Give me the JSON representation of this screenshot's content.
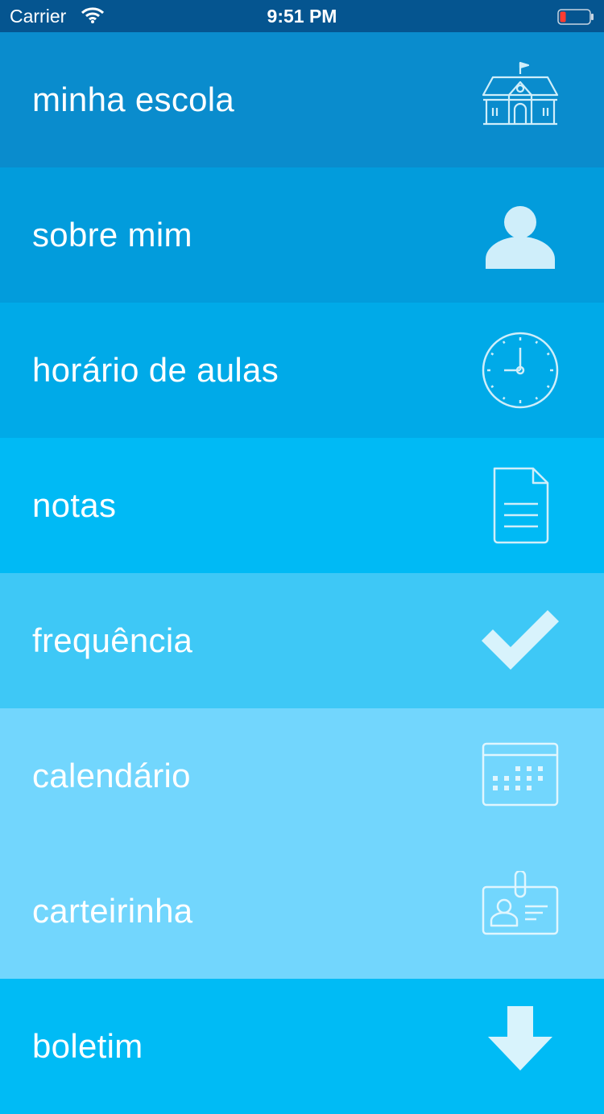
{
  "status_bar": {
    "carrier": "Carrier",
    "time": "9:51 PM",
    "wifi_icon": "wifi-icon",
    "battery_icon": "battery-low-icon",
    "battery_color": "#ff3b30"
  },
  "menu": {
    "items": [
      {
        "label": "minha escola",
        "icon": "school-icon",
        "color": "#0a8ccd"
      },
      {
        "label": "sobre mim",
        "icon": "person-icon",
        "color": "#029cdc"
      },
      {
        "label": "horário de aulas",
        "icon": "clock-icon",
        "color": "#00aae8"
      },
      {
        "label": "notas",
        "icon": "document-icon",
        "color": "#00baf5"
      },
      {
        "label": "frequência",
        "icon": "checkmark-icon",
        "color": "#3ec8f6"
      },
      {
        "label": "calendário",
        "icon": "calendar-icon",
        "color": "#72d6fd"
      },
      {
        "label": "carteirinha",
        "icon": "id-card-icon",
        "color": "#72d6fd"
      },
      {
        "label": "boletim",
        "icon": "download-arrow-icon",
        "color": "#00bbf5"
      }
    ]
  }
}
